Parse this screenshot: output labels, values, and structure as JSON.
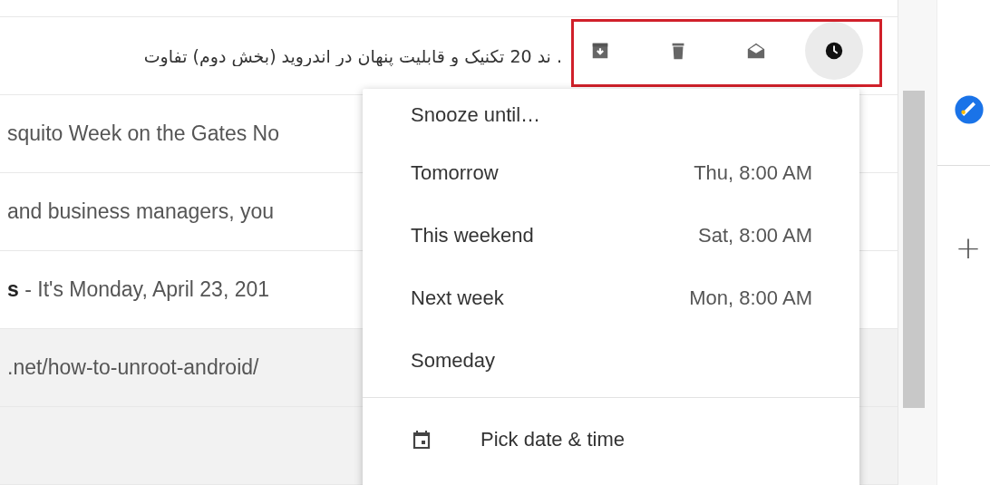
{
  "email_rows": [
    {
      "text": ". ند 20 تکنیک و قابلیت پنهان در اندروید (بخش دوم) تفاوت",
      "kind": "rtl",
      "highlighted": false
    },
    {
      "text": "squito Week on the Gates No",
      "kind": "ltr",
      "highlighted": false
    },
    {
      "text": "and business managers, you",
      "kind": "ltr",
      "highlighted": false
    },
    {
      "text": "**s** - It's Monday, April 23, 201",
      "kind": "ltr",
      "highlighted": false
    },
    {
      "text": ".net/how-to-unroot-android/",
      "kind": "ltr",
      "highlighted": true
    },
    {
      "highlighted": true
    }
  ],
  "row_actions": [
    {
      "kind": "archive",
      "active": false
    },
    {
      "kind": "delete",
      "active": false
    },
    {
      "kind": "mark_read",
      "active": false
    },
    {
      "kind": "snooze",
      "active": true
    }
  ],
  "snooze_menu": {
    "title": "Snooze until…",
    "options": [
      {
        "label": "Tomorrow",
        "time": "Thu, 8:00 AM"
      },
      {
        "label": "This weekend",
        "time": "Sat, 8:00 AM"
      },
      {
        "label": "Next week",
        "time": "Mon, 8:00 AM"
      },
      {
        "label": "Someday"
      }
    ],
    "custom": {
      "label": "Pick date & time"
    }
  },
  "side_panel": {
    "add": "+"
  }
}
